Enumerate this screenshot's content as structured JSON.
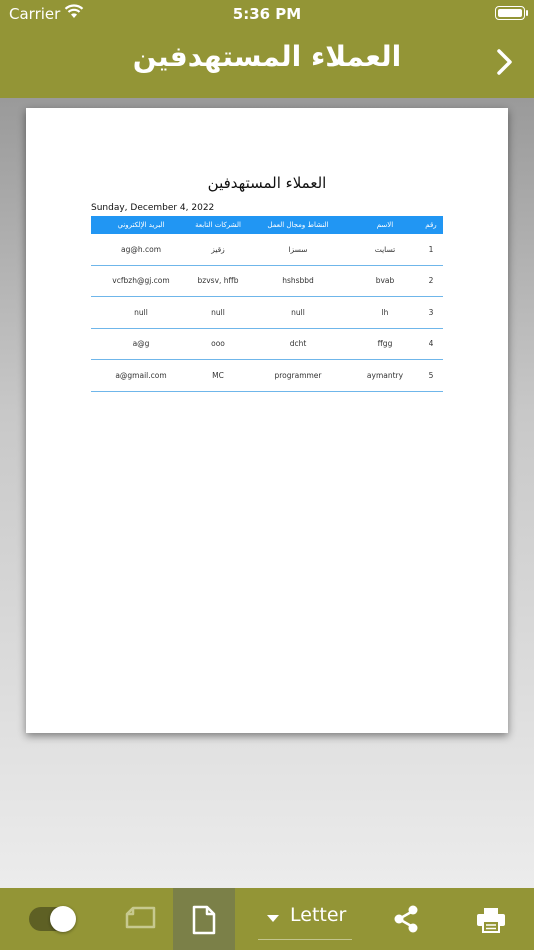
{
  "status_bar": {
    "carrier": "Carrier",
    "time": "5:36 PM"
  },
  "header": {
    "title": "العملاء المستهدفين"
  },
  "document": {
    "title": "العملاء المستهدفين",
    "date": "Sunday, December 4, 2022",
    "columns": [
      "رقم",
      "الاسم",
      "النشاط ومجال العمل",
      "الشركات التابعة",
      "البريد الإلكتروني"
    ],
    "rows": [
      [
        "1",
        "تسايت",
        "سسزا",
        "زقيز",
        "ag@h.com"
      ],
      [
        "2",
        "bvab",
        "hshsbbd",
        "bzvsv, hffb",
        "vcfbzh@gj.com"
      ],
      [
        "3",
        "lh",
        "null",
        "null",
        "null"
      ],
      [
        "4",
        "ffgg",
        "dcht",
        "ooo",
        "a@g"
      ],
      [
        "5",
        "aymantry",
        "programmer",
        "MC",
        "a@gmail.com"
      ]
    ]
  },
  "toolbar": {
    "paper_size": "Letter",
    "color_toggle_on": true
  },
  "colors": {
    "header": "#939536",
    "table_header": "#2196f3",
    "row_divider": "#6fb6ea"
  }
}
